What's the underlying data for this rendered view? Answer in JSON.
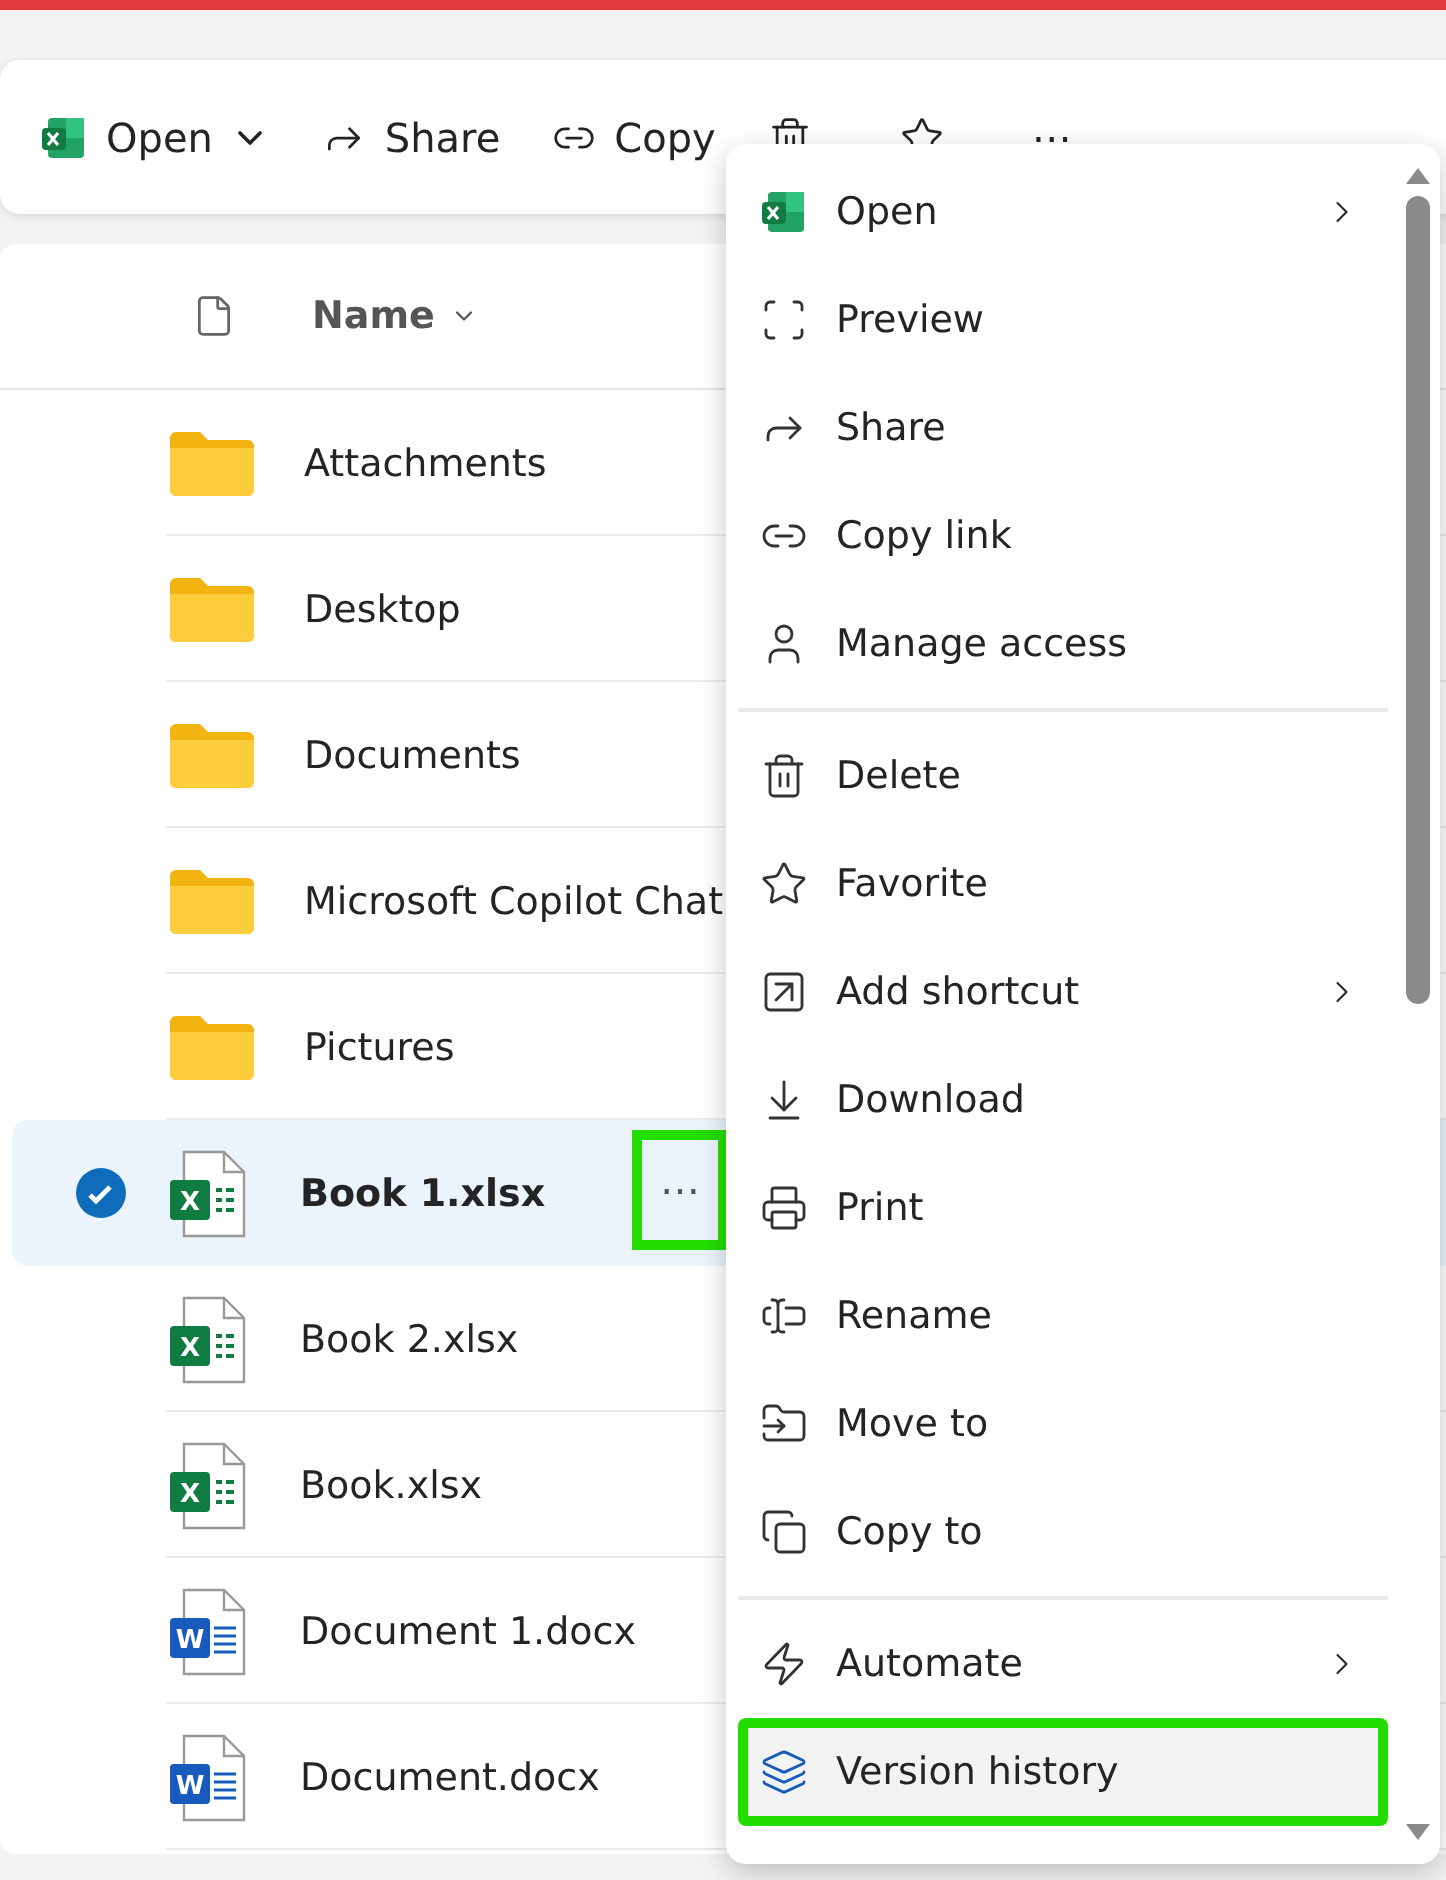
{
  "toolbar": [
    {
      "label": "Open",
      "kind": "app",
      "dropdown": true
    },
    {
      "label": "Share",
      "kind": "share",
      "dropdown": false
    },
    {
      "label": "Copy",
      "kind": "link",
      "dropdown": false
    },
    {
      "kind": "delete",
      "dropdown": false
    },
    {
      "kind": "favorite",
      "dropdown": false
    },
    {
      "label": "⋯",
      "kind": "more",
      "dropdown": false
    }
  ],
  "files": {
    "header": {
      "label": "Name"
    },
    "rows": [
      {
        "name": "Attachments",
        "kind": "folder",
        "selected": false
      },
      {
        "name": "Desktop",
        "kind": "folder",
        "selected": false
      },
      {
        "name": "Documents",
        "kind": "folder",
        "selected": false
      },
      {
        "name": "Microsoft Copilot Chat",
        "kind": "folder",
        "selected": false
      },
      {
        "name": "Pictures",
        "kind": "folder",
        "selected": false
      },
      {
        "name": "Book 1.xlsx",
        "kind": "excel",
        "badge": "X",
        "selected": true,
        "more": {
          "label": "⋯",
          "highlighted": true
        }
      },
      {
        "name": "Book 2.xlsx",
        "kind": "excel",
        "badge": "X",
        "selected": false
      },
      {
        "name": "Book.xlsx",
        "kind": "excel",
        "badge": "X",
        "selected": false
      },
      {
        "name": "Document 1.docx",
        "kind": "word",
        "badge": "W",
        "selected": false
      },
      {
        "name": "Document.docx",
        "kind": "word",
        "badge": "W",
        "selected": false
      }
    ]
  },
  "menu": {
    "groups": [
      [
        {
          "label": "Open",
          "submenu": true,
          "hovered": false,
          "highlighted": false
        },
        {
          "label": "Preview",
          "submenu": false,
          "hovered": false,
          "highlighted": false
        },
        {
          "label": "Share",
          "submenu": false,
          "hovered": false,
          "highlighted": false
        },
        {
          "label": "Copy link",
          "submenu": false,
          "hovered": false,
          "highlighted": false
        },
        {
          "label": "Manage access",
          "submenu": false,
          "hovered": false,
          "highlighted": false
        }
      ],
      [
        {
          "label": "Delete",
          "submenu": false,
          "hovered": false,
          "highlighted": false
        },
        {
          "label": "Favorite",
          "submenu": false,
          "hovered": false,
          "highlighted": false
        },
        {
          "label": "Add shortcut",
          "submenu": true,
          "hovered": false,
          "highlighted": false
        },
        {
          "label": "Download",
          "submenu": false,
          "hovered": false,
          "highlighted": false
        },
        {
          "label": "Print",
          "submenu": false,
          "hovered": false,
          "highlighted": false
        },
        {
          "label": "Rename",
          "submenu": false,
          "hovered": false,
          "highlighted": false
        },
        {
          "label": "Move to",
          "submenu": false,
          "hovered": false,
          "highlighted": false
        },
        {
          "label": "Copy to",
          "submenu": false,
          "hovered": false,
          "highlighted": false
        }
      ],
      [
        {
          "label": "Automate",
          "submenu": true,
          "hovered": false,
          "highlighted": false
        },
        {
          "label": "Version history",
          "submenu": false,
          "hovered": true,
          "highlighted": true
        }
      ]
    ]
  }
}
